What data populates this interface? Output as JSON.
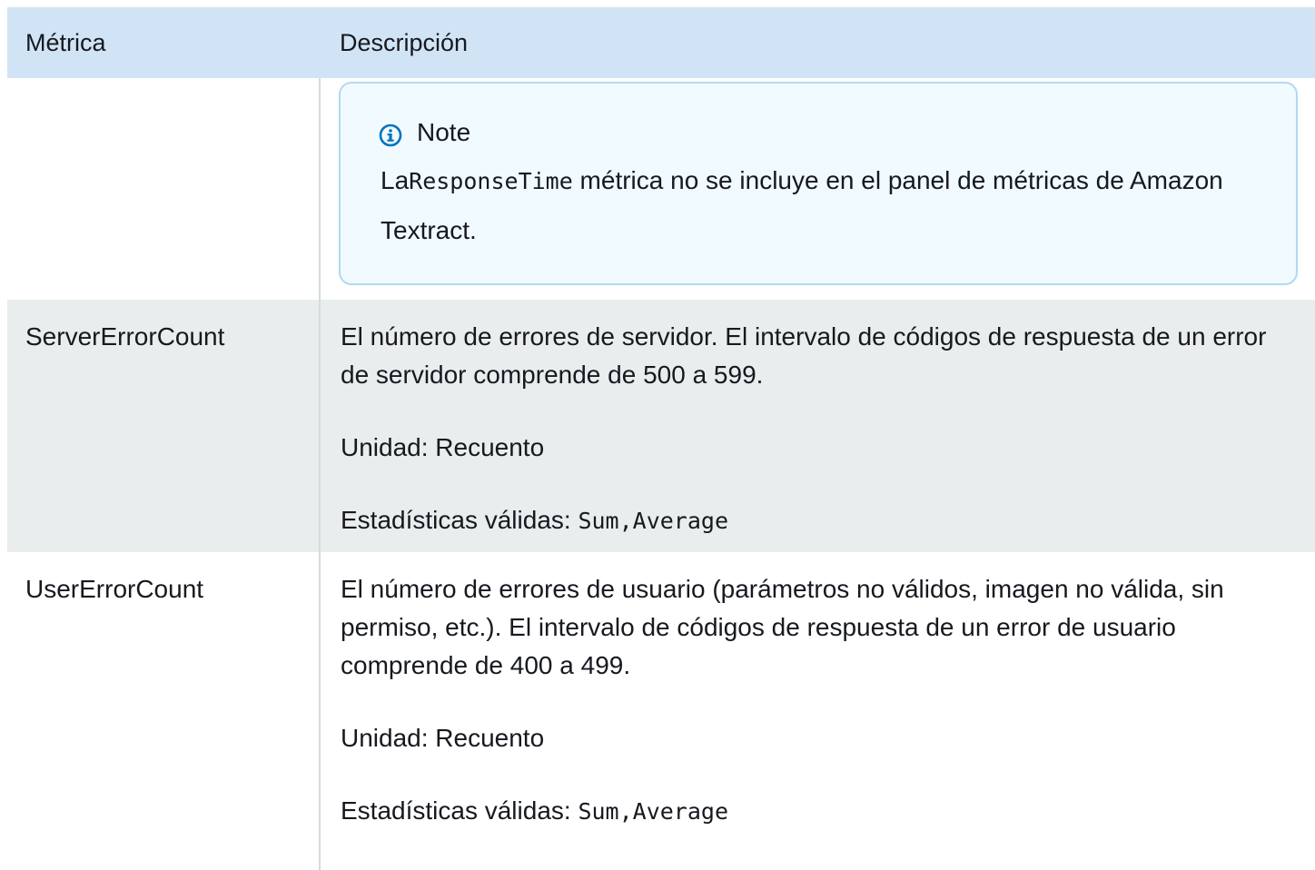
{
  "table": {
    "headers": {
      "metric": "Métrica",
      "description": "Descripción"
    },
    "note": {
      "title": "Note",
      "prefix": "La",
      "code": "ResponseTime",
      "text_after_code": " métrica no se incluye en el panel de métricas de Amazon Textract."
    },
    "rows": [
      {
        "metric": "ServerErrorCount",
        "description": "El número de errores de servidor. El intervalo de códigos de respuesta de un error de servidor comprende de 500 a 599.",
        "unit": "Unidad: Recuento",
        "stats_label": "Estadísticas válidas: ",
        "stats_values": "Sum,Average"
      },
      {
        "metric": "UserErrorCount",
        "description": "El número de errores de usuario (parámetros no válidos, imagen no válida, sin permiso, etc.). El intervalo de códigos de respuesta de un error de usuario comprende de 400 a 499.",
        "unit": "Unidad: Recuento",
        "stats_label": "Estadísticas válidas: ",
        "stats_values": "Sum,Average"
      }
    ]
  },
  "colors": {
    "header_bg": "#d1e4f6",
    "striped_row_bg": "#eaeded",
    "note_border": "#b2d8f1",
    "note_bg": "#f1faff",
    "info_icon": "#0073bb"
  }
}
